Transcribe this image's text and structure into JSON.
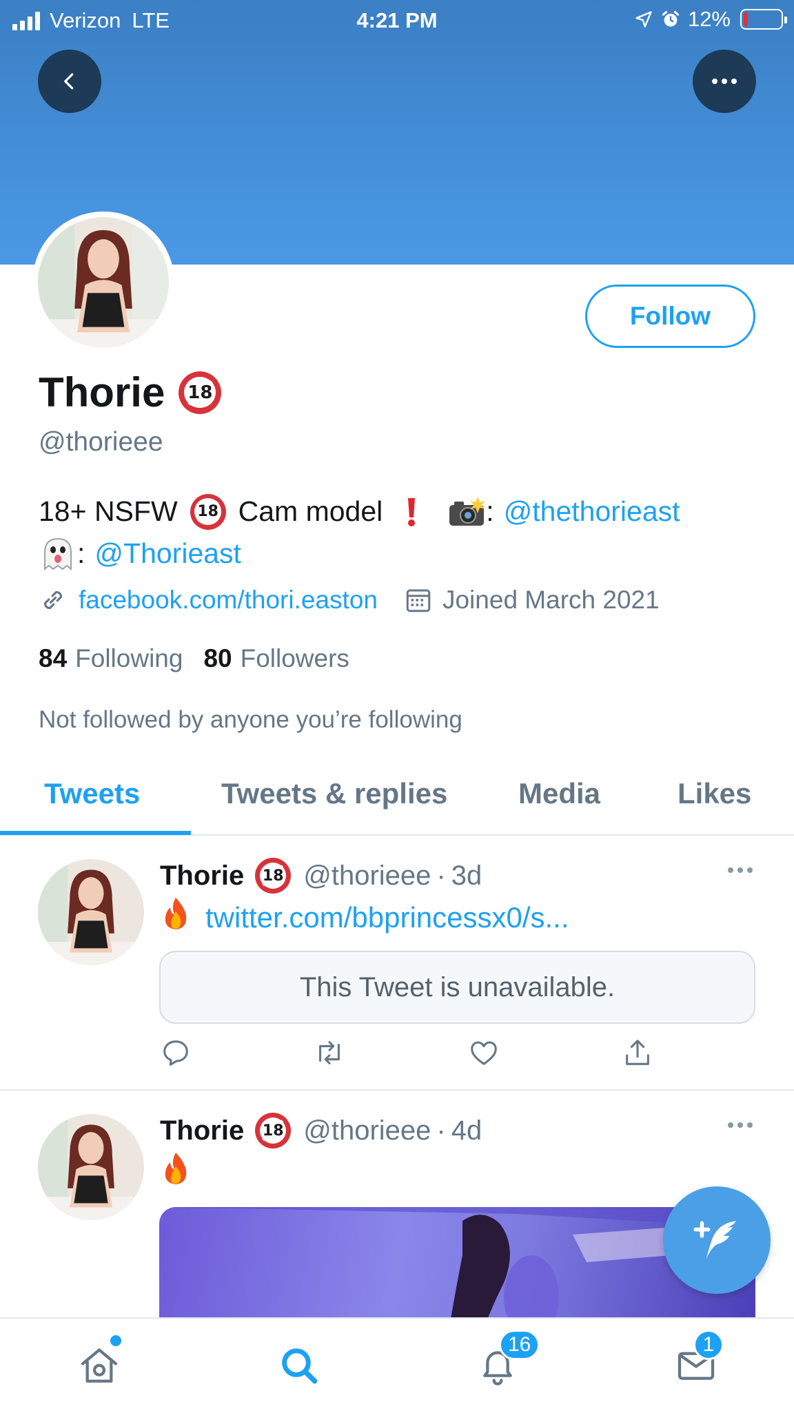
{
  "status_bar": {
    "carrier": "Verizon",
    "network": "LTE",
    "time": "4:21 PM",
    "battery": "12%",
    "battery_level": 0.12
  },
  "header": {
    "back_icon": "chevron-left-icon",
    "more_icon": "more-horizontal-icon"
  },
  "profile": {
    "follow_label": "Follow",
    "name": "Thorie",
    "name_badge": "18",
    "handle": "@thorieee",
    "bio_line1_a": "18+ NSFW",
    "bio_line1_b": "Cam model",
    "bio_line1_colon": ":",
    "bio_line1_link": "@thethorieast",
    "bio_line2_colon": ":",
    "bio_line2_link": "@Thorieast",
    "website": "facebook.com/thori.easton",
    "joined": "Joined March 2021",
    "following_count": "84",
    "following_label": "Following",
    "followers_count": "80",
    "followers_label": "Followers",
    "mutuals_note": "Not followed by anyone you’re following"
  },
  "tabs": [
    {
      "label": "Tweets",
      "active": true
    },
    {
      "label": "Tweets & replies",
      "active": false
    },
    {
      "label": "Media",
      "active": false
    },
    {
      "label": "Likes",
      "active": false
    }
  ],
  "tweets": [
    {
      "name": "Thorie",
      "badge": "18",
      "handle": "@thorieee",
      "separator": "·",
      "time": "3d",
      "link": "twitter.com/bbprincessx0/s...",
      "quoted_notice": "This Tweet is unavailable."
    },
    {
      "name": "Thorie",
      "badge": "18",
      "handle": "@thorieee",
      "separator": "·",
      "time": "4d"
    }
  ],
  "bottom_nav": {
    "notifications_badge": "16",
    "messages_badge": "1"
  },
  "colors": {
    "accent": "#1da1f2",
    "banner_top": "#3b7fc4",
    "banner_bottom": "#4a99e6",
    "muted_text": "#657786"
  }
}
